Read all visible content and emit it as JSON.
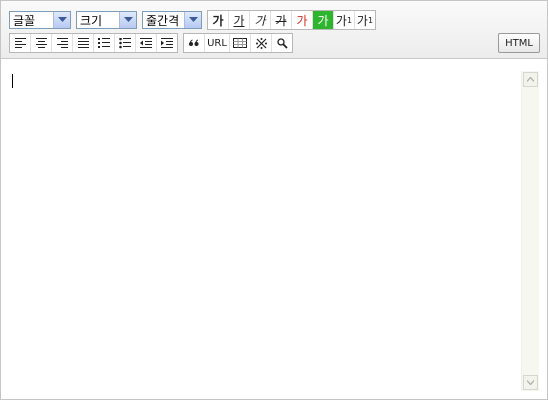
{
  "toolbar": {
    "font_select": {
      "value": "글꼴"
    },
    "size_select": {
      "value": "크기"
    },
    "lineheight_select": {
      "value": "줄간격"
    },
    "format_buttons": [
      {
        "label": "가",
        "meaning": "bold"
      },
      {
        "label": "가",
        "meaning": "underline"
      },
      {
        "label": "가",
        "meaning": "italic"
      },
      {
        "label": "가",
        "meaning": "strikethrough"
      },
      {
        "label": "가",
        "meaning": "font-color"
      },
      {
        "label": "가",
        "meaning": "background-color"
      },
      {
        "label": "가",
        "sup": "1",
        "meaning": "superscript"
      },
      {
        "label": "가",
        "sub": "1",
        "meaning": "subscript"
      }
    ],
    "insert_buttons": {
      "url_label": "URL"
    },
    "html_button": "HTML"
  },
  "icons": [
    "align-left-icon",
    "align-center-icon",
    "align-right-icon",
    "justify-icon",
    "ordered-list-icon",
    "unordered-list-icon",
    "outdent-icon",
    "indent-icon",
    "quote-icon",
    "table-icon",
    "special-char-icon",
    "search-icon"
  ],
  "colors": {
    "font_color": "#d62b1f",
    "highlight": "#2db52d",
    "select_border": "#7f9db9"
  }
}
